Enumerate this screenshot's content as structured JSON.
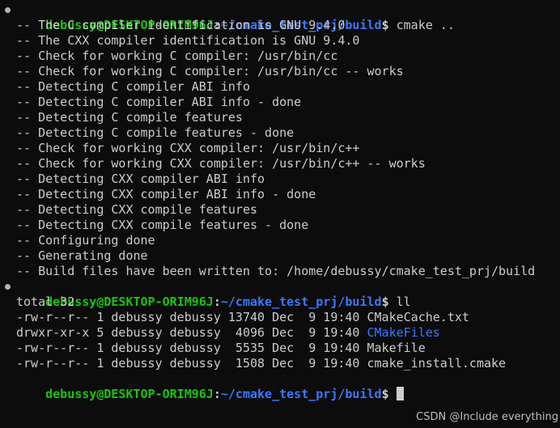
{
  "prompt": {
    "user_host": "debussy@DESKTOP-ORIM96J",
    "colon": ":",
    "path": "~/cmake_test_prj/build",
    "dollar": "$"
  },
  "commands": {
    "first": " cmake ..",
    "second": " ll",
    "third": " "
  },
  "cmake_output": [
    "-- The C compiler identification is GNU 9.4.0",
    "-- The CXX compiler identification is GNU 9.4.0",
    "-- Check for working C compiler: /usr/bin/cc",
    "-- Check for working C compiler: /usr/bin/cc -- works",
    "-- Detecting C compiler ABI info",
    "-- Detecting C compiler ABI info - done",
    "-- Detecting C compile features",
    "-- Detecting C compile features - done",
    "-- Check for working CXX compiler: /usr/bin/c++",
    "-- Check for working CXX compiler: /usr/bin/c++ -- works",
    "-- Detecting CXX compiler ABI info",
    "-- Detecting CXX compiler ABI info - done",
    "-- Detecting CXX compile features",
    "-- Detecting CXX compile features - done",
    "-- Configuring done",
    "-- Generating done",
    "-- Build files have been written to: /home/debussy/cmake_test_prj/build"
  ],
  "ll_output": {
    "total": "total 32",
    "entries": [
      {
        "meta": "-rw-r--r-- 1 debussy debussy 13740 Dec  9 19:40 ",
        "name": "CMakeCache.txt"
      },
      {
        "meta": "drwxr-xr-x 5 debussy debussy  4096 Dec  9 19:40 ",
        "name": "CMakeFiles"
      },
      {
        "meta": "-rw-r--r-- 1 debussy debussy  5535 Dec  9 19:40 ",
        "name": "Makefile"
      },
      {
        "meta": "-rw-r--r-- 1 debussy debussy  1508 Dec  9 19:40 ",
        "name": "cmake_install.cmake"
      }
    ]
  },
  "colors": {
    "background": "#0c0c0c",
    "user_host": "#16c60c",
    "path": "#3b78ff",
    "directory": "#3b78ff",
    "text": "#cccccc"
  },
  "watermark": "CSDN @Include everything"
}
